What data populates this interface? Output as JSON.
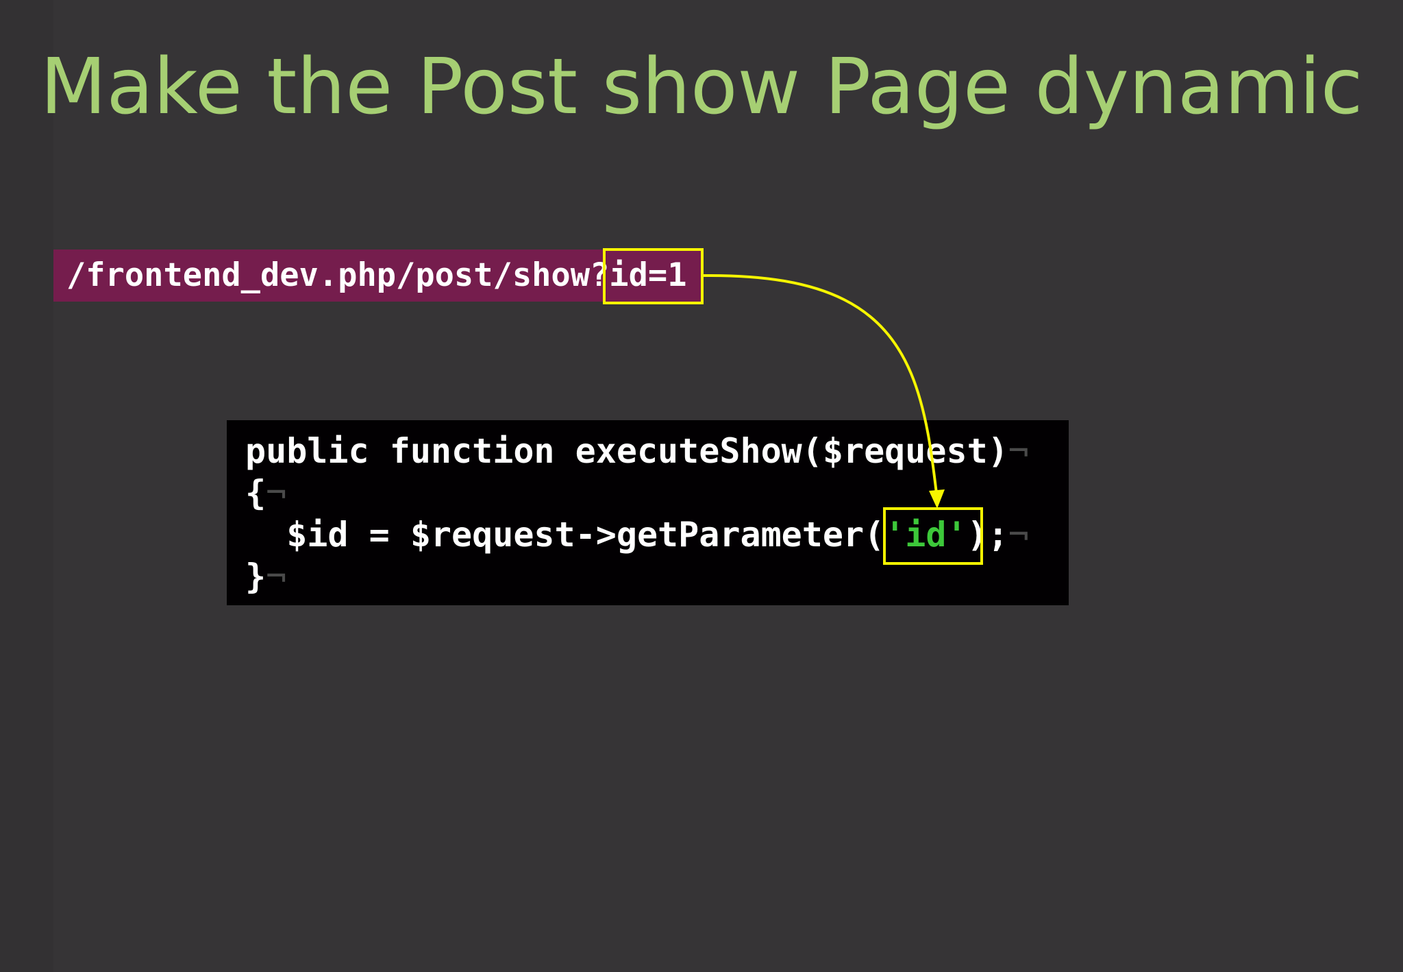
{
  "slide": {
    "title": "Make the Post show Page dynamic"
  },
  "url": {
    "text": "/frontend_dev.php/post/show?id=1"
  },
  "code": {
    "line1": "public function executeShow($request)",
    "line2": "{",
    "line3_before": "  $id = $request->getParameter(",
    "line3_string": "'id'",
    "line3_after": ");",
    "line4": "}",
    "eol_marker": "¬"
  },
  "colors": {
    "background": "#363436",
    "title": "#a6cf73",
    "url_bar": "#751d4d",
    "highlight": "#f6f500",
    "code_background": "#020002",
    "code_string": "#3dc83a"
  }
}
